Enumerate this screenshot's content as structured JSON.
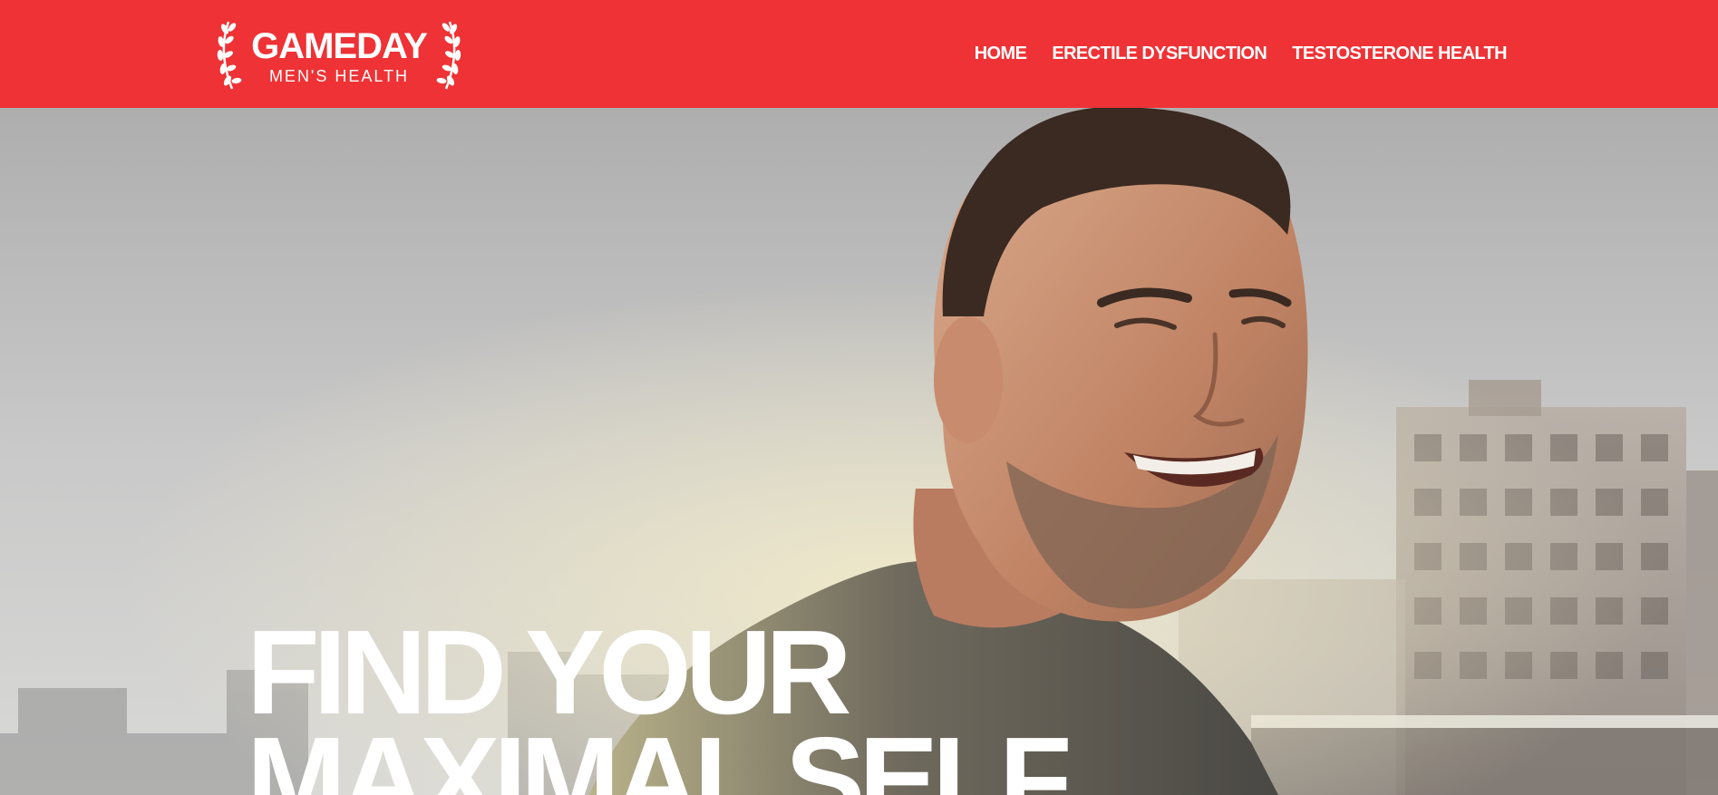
{
  "brand": {
    "name": "GAMEDAY",
    "tagline": "MEN'S HEALTH"
  },
  "nav": {
    "items": [
      {
        "label": "HOME"
      },
      {
        "label": "ERECTILE DYSFUNCTION"
      },
      {
        "label": "TESTOSTERONE HEALTH"
      }
    ]
  },
  "hero": {
    "headline_line1": "FIND YOUR",
    "headline_line2": "MAXIMAL SELF",
    "image": "smiling-man-outdoors-photo"
  },
  "colors": {
    "header_bg": "#ee3235",
    "nav_text": "#ffffff",
    "headline_text": "#ffffff"
  }
}
